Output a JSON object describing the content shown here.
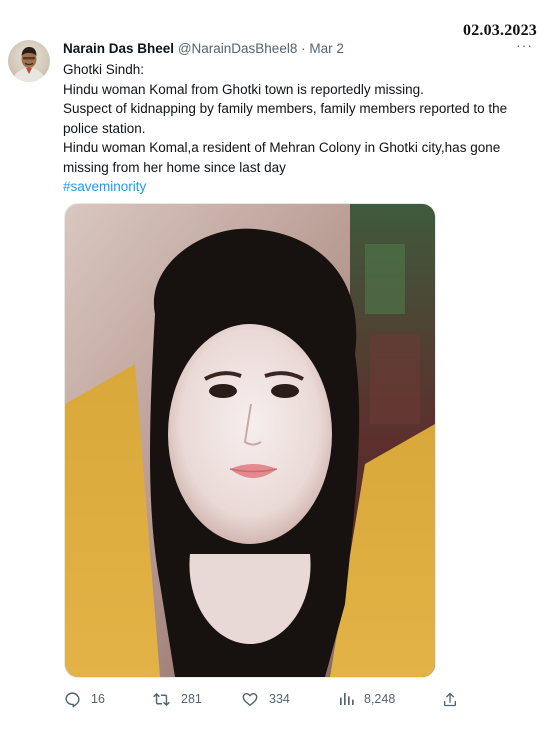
{
  "stamp": {
    "date": "02.03.2023"
  },
  "tweet": {
    "author_name": "Narain Das Bheel",
    "handle": "@NarainDasBheel8",
    "separator": "·",
    "time": "Mar 2",
    "more_label": "···",
    "lines": [
      "Ghotki Sindh:",
      "Hindu woman Komal from Ghotki town is reportedly missing.",
      "Suspect of kidnapping by family members, family members reported to the police station.",
      "Hindu woman Komal,a resident of Mehran Colony in Ghotki city,has gone missing from her home since last day"
    ],
    "hashtag": "#saveminority"
  },
  "actions": {
    "replies": "16",
    "retweets": "281",
    "likes": "334",
    "views": "8,248"
  },
  "icons": {
    "reply": "reply-icon",
    "retweet": "retweet-icon",
    "like": "heart-icon",
    "views": "views-chart-icon",
    "share": "share-icon"
  },
  "colors": {
    "text": "#0f1419",
    "muted": "#536471",
    "link": "#1d9bf0"
  }
}
